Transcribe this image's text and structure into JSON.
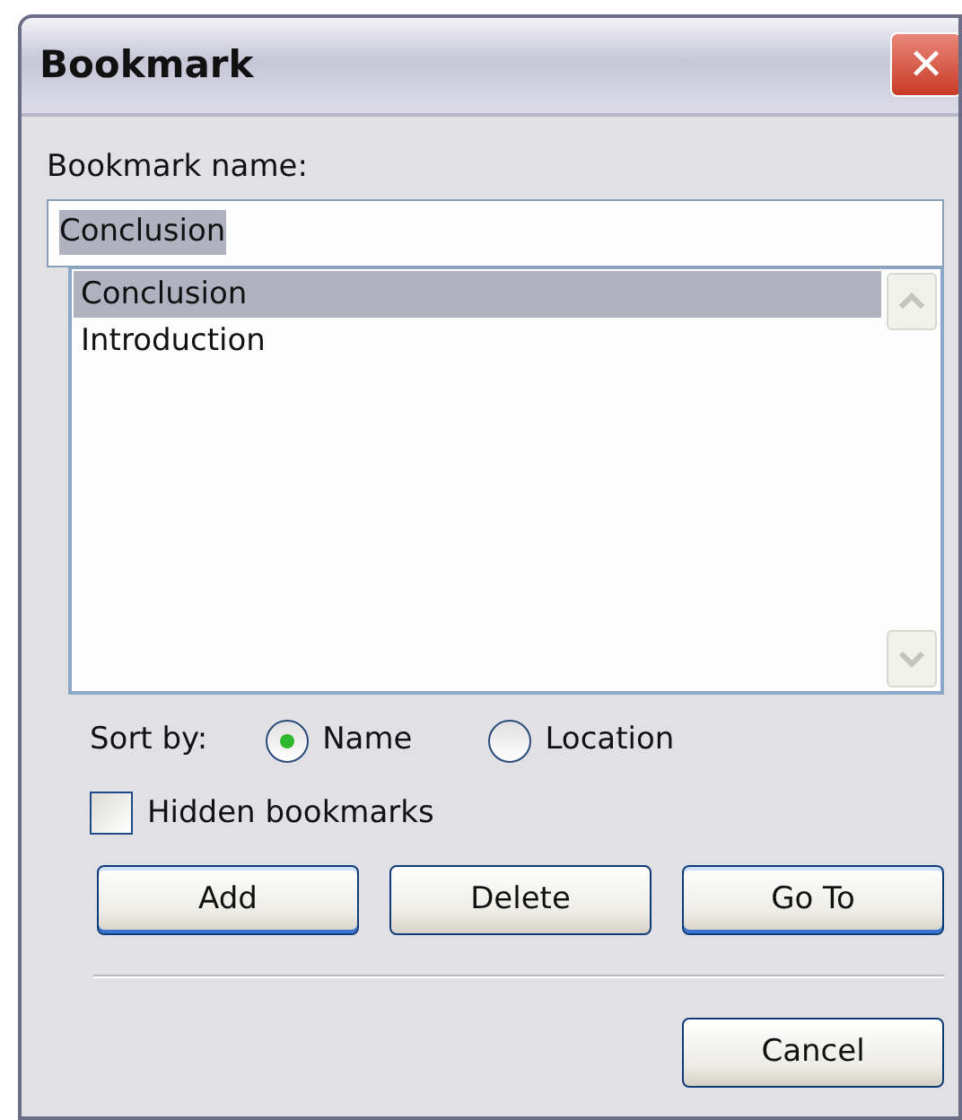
{
  "window": {
    "title": "Bookmark",
    "close": "✕"
  },
  "name_label": "Bookmark name:",
  "name_field": {
    "value": "Conclusion",
    "selected": true
  },
  "bookmarks": [
    {
      "label": "Conclusion",
      "selected": true
    },
    {
      "label": "Introduction",
      "selected": false
    }
  ],
  "sort_label": "Sort by:",
  "sort_options": [
    {
      "label": "Name",
      "selected": true
    },
    {
      "label": "Location",
      "selected": false
    }
  ],
  "hidden_bookmarks": {
    "label": "Hidden bookmarks",
    "checked": false
  },
  "buttons": [
    "Add",
    "Delete",
    "Go To"
  ],
  "cancel": "Cancel"
}
